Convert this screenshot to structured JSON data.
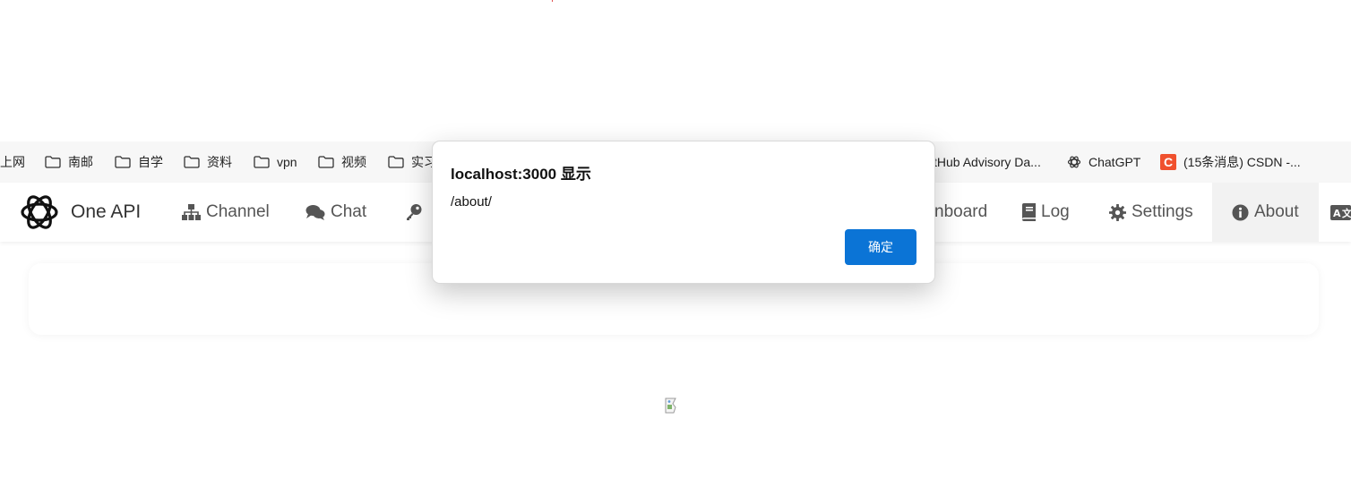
{
  "bookmarks": [
    {
      "label": "上网"
    },
    {
      "label": "南邮",
      "icon": "folder-icon"
    },
    {
      "label": "自学",
      "icon": "folder-icon"
    },
    {
      "label": "资料",
      "icon": "folder-icon"
    },
    {
      "label": "vpn",
      "icon": "folder-icon"
    },
    {
      "label": "视频",
      "icon": "folder-icon"
    },
    {
      "label": "实习",
      "icon": "folder-icon"
    },
    {
      "label": "tHub Advisory Da..."
    },
    {
      "label": "ChatGPT",
      "icon": "openai-icon"
    },
    {
      "label": "(15条消息) CSDN -...",
      "icon": "csdn-icon"
    }
  ],
  "csdn_letter": "C",
  "navbar": {
    "brand": "One API",
    "items": [
      {
        "label": "Channel",
        "icon": "sitemap-icon"
      },
      {
        "label": "Chat",
        "icon": "chat-icon"
      },
      {
        "label": "",
        "icon": "key-icon"
      },
      {
        "label": "nboard"
      },
      {
        "label": "Log",
        "icon": "book-icon"
      },
      {
        "label": "Settings",
        "icon": "gear-icon"
      },
      {
        "label": "About",
        "icon": "info-icon",
        "active": true
      },
      {
        "label": "",
        "icon": "language-icon"
      }
    ]
  },
  "dialog": {
    "title": "localhost:3000 显示",
    "message": "/about/",
    "ok_label": "确定"
  },
  "colors": {
    "accent": "#0b74d6",
    "nav_text": "#555555",
    "active_bg": "#f2f2f2",
    "csdn": "#f0512e"
  }
}
